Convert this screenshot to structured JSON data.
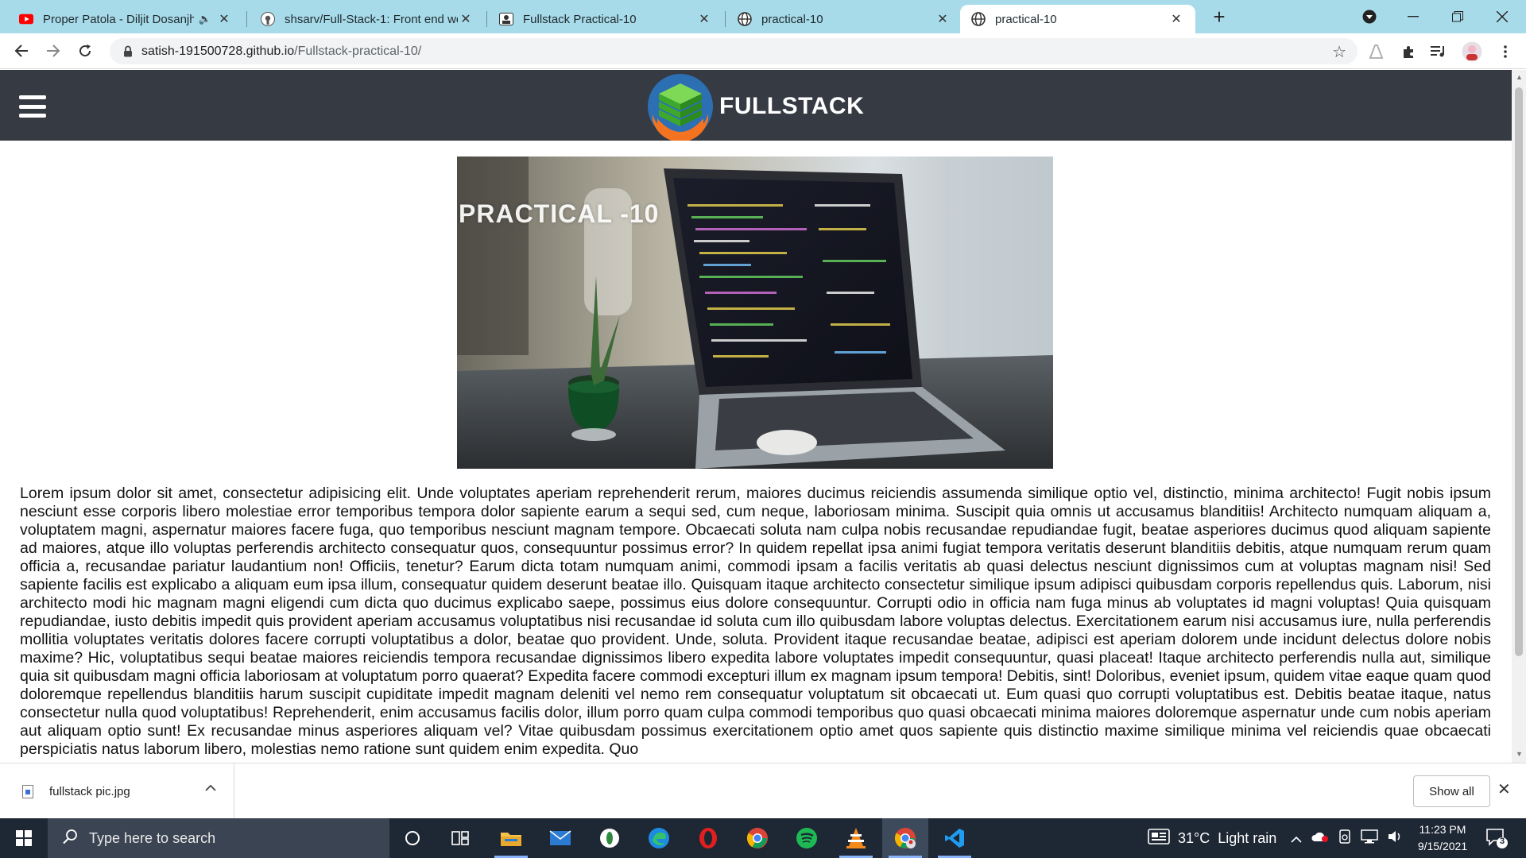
{
  "browser": {
    "tabs": [
      {
        "title": "Proper Patola - Diljit Dosanjh",
        "icon": "youtube-icon",
        "audio": true
      },
      {
        "title": "shsarv/Full-Stack-1: Front end we",
        "icon": "github-icon"
      },
      {
        "title": "Fullstack Practical-10",
        "icon": "page-icon"
      },
      {
        "title": "practical-10",
        "icon": "globe-icon"
      },
      {
        "title": "practical-10",
        "icon": "globe-icon",
        "active": true
      }
    ],
    "url_host": "satish-191500728.github.io",
    "url_path": "/Fullstack-practical-10/"
  },
  "site": {
    "brand": "FULLSTACK",
    "hero_title": "PRACTICAL -10",
    "body_text": "Lorem ipsum dolor sit amet, consectetur adipisicing elit. Unde voluptates aperiam reprehenderit rerum, maiores ducimus reiciendis assumenda similique optio vel, distinctio, minima architecto! Fugit nobis ipsum nesciunt esse corporis libero molestiae error temporibus tempora dolor sapiente earum a sequi sed, cum neque, laboriosam minima. Suscipit quia omnis ut accusamus blanditiis! Architecto numquam aliquam a, voluptatem magni, aspernatur maiores facere fuga, quo temporibus nesciunt magnam tempore. Obcaecati soluta nam culpa nobis recusandae repudiandae fugit, beatae asperiores ducimus quod aliquam sapiente ad maiores, atque illo voluptas perferendis architecto consequatur quos, consequuntur possimus error? In quidem repellat ipsa animi fugiat tempora veritatis deserunt blanditiis debitis, atque numquam rerum quam officia a, recusandae pariatur laudantium non! Officiis, tenetur? Earum dicta totam numquam animi, commodi ipsam a facilis veritatis ab quasi delectus nesciunt dignissimos cum at voluptas magnam nisi! Sed sapiente facilis est explicabo a aliquam eum ipsa illum, consequatur quidem deserunt beatae illo. Quisquam itaque architecto consectetur similique ipsum adipisci quibusdam corporis repellendus quis. Laborum, nisi architecto modi hic magnam magni eligendi cum dicta quo ducimus explicabo saepe, possimus eius dolore consequuntur. Corrupti odio in officia nam fuga minus ab voluptates id magni voluptas! Quia quisquam repudiandae, iusto debitis impedit quis provident aperiam accusamus voluptatibus nisi recusandae id soluta cum illo quibusdam labore voluptas delectus. Exercitationem earum nisi accusamus iure, nulla perferendis mollitia voluptates veritatis dolores facere corrupti voluptatibus a dolor, beatae quo provident. Unde, soluta. Provident itaque recusandae beatae, adipisci est aperiam dolorem unde incidunt delectus dolore nobis maxime? Hic, voluptatibus sequi beatae maiores reiciendis tempora recusandae dignissimos libero expedita labore voluptates impedit consequuntur, quasi placeat! Itaque architecto perferendis nulla aut, similique quia sit quibusdam magni officia laboriosam at voluptatum porro quaerat? Expedita facere commodi excepturi illum ex magnam ipsum tempora! Debitis, sint! Doloribus, eveniet ipsum, quidem vitae eaque quam quod doloremque repellendus blanditiis harum suscipit cupiditate impedit magnam deleniti vel nemo rem consequatur voluptatum sit obcaecati ut. Eum quasi quo corrupti voluptatibus est. Debitis beatae itaque, natus consectetur nulla quod voluptatibus! Reprehenderit, enim accusamus facilis dolor, illum porro quam culpa commodi temporibus quo quasi obcaecati minima maiores doloremque aspernatur unde cum nobis aperiam aut aliquam optio sunt! Ex recusandae minus asperiores aliquam vel? Vitae quibusdam possimus exercitationem optio amet quos sapiente quis distinctio maxime similique minima vel reiciendis quae obcaecati perspiciatis natus laborum libero, molestias nemo ratione sunt quidem enim expedita. Quo"
  },
  "downloads": {
    "file_name": "fullstack pic.jpg",
    "show_all": "Show all"
  },
  "taskbar": {
    "search_placeholder": "Type here to search",
    "apps": [
      "cortana-icon",
      "task-view-icon",
      "file-explorer-icon",
      "mail-icon",
      "app-icon",
      "edge-icon",
      "opera-icon",
      "chrome-icon",
      "spotify-icon",
      "vlc-icon",
      "chrome-active-icon",
      "vscode-icon"
    ],
    "weather": "31°C  Light rain",
    "time": "11:23 PM",
    "date": "9/15/2021",
    "notifications": "3"
  },
  "colors": {
    "tabstrip": "#a8dbe9",
    "site_header": "#363a42",
    "taskbar": "#1e2734"
  }
}
